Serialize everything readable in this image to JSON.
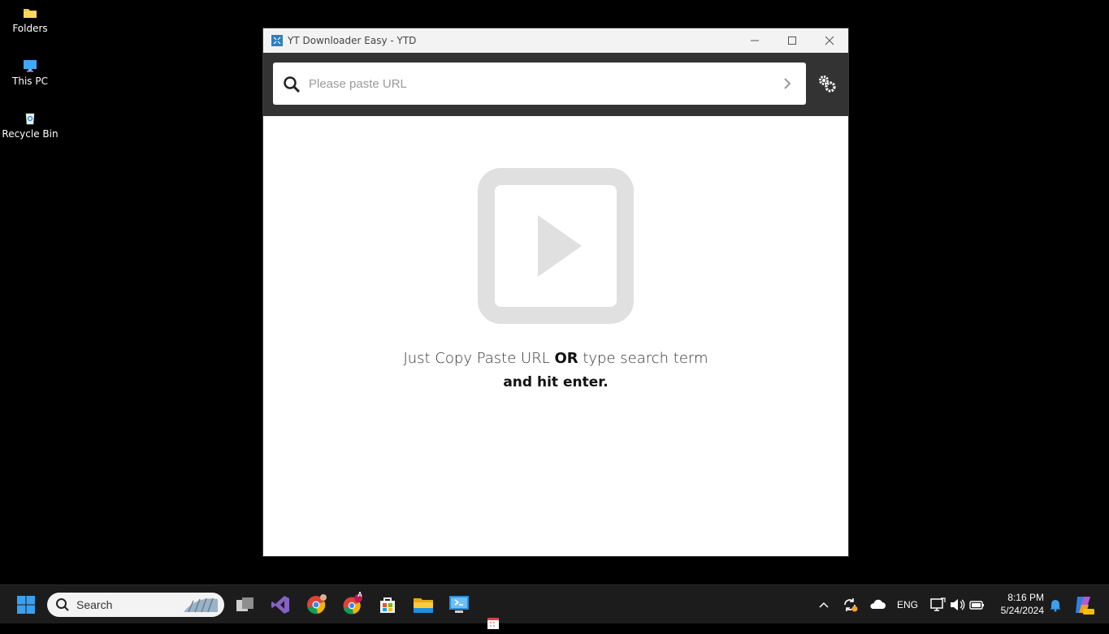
{
  "desktop": {
    "icons": [
      {
        "label": "Folders"
      },
      {
        "label": "This PC"
      },
      {
        "label": "Recycle Bin"
      }
    ]
  },
  "window": {
    "title": "YT Downloader Easy - YTD",
    "search": {
      "placeholder": "Please paste URL",
      "value": ""
    },
    "hint": {
      "part1": "Just Copy Paste URL ",
      "or": "OR",
      "part2": " type search term",
      "line2": "and hit enter."
    }
  },
  "taskbar": {
    "search_label": "Search",
    "language": "ENG",
    "time": "8:16 PM",
    "date": "5/24/2024",
    "chrome_badge": "A"
  },
  "colors": {
    "toolbar_bg": "#333333",
    "placeholder_icon": "#e0e0e0",
    "accent": "#0078d4"
  }
}
